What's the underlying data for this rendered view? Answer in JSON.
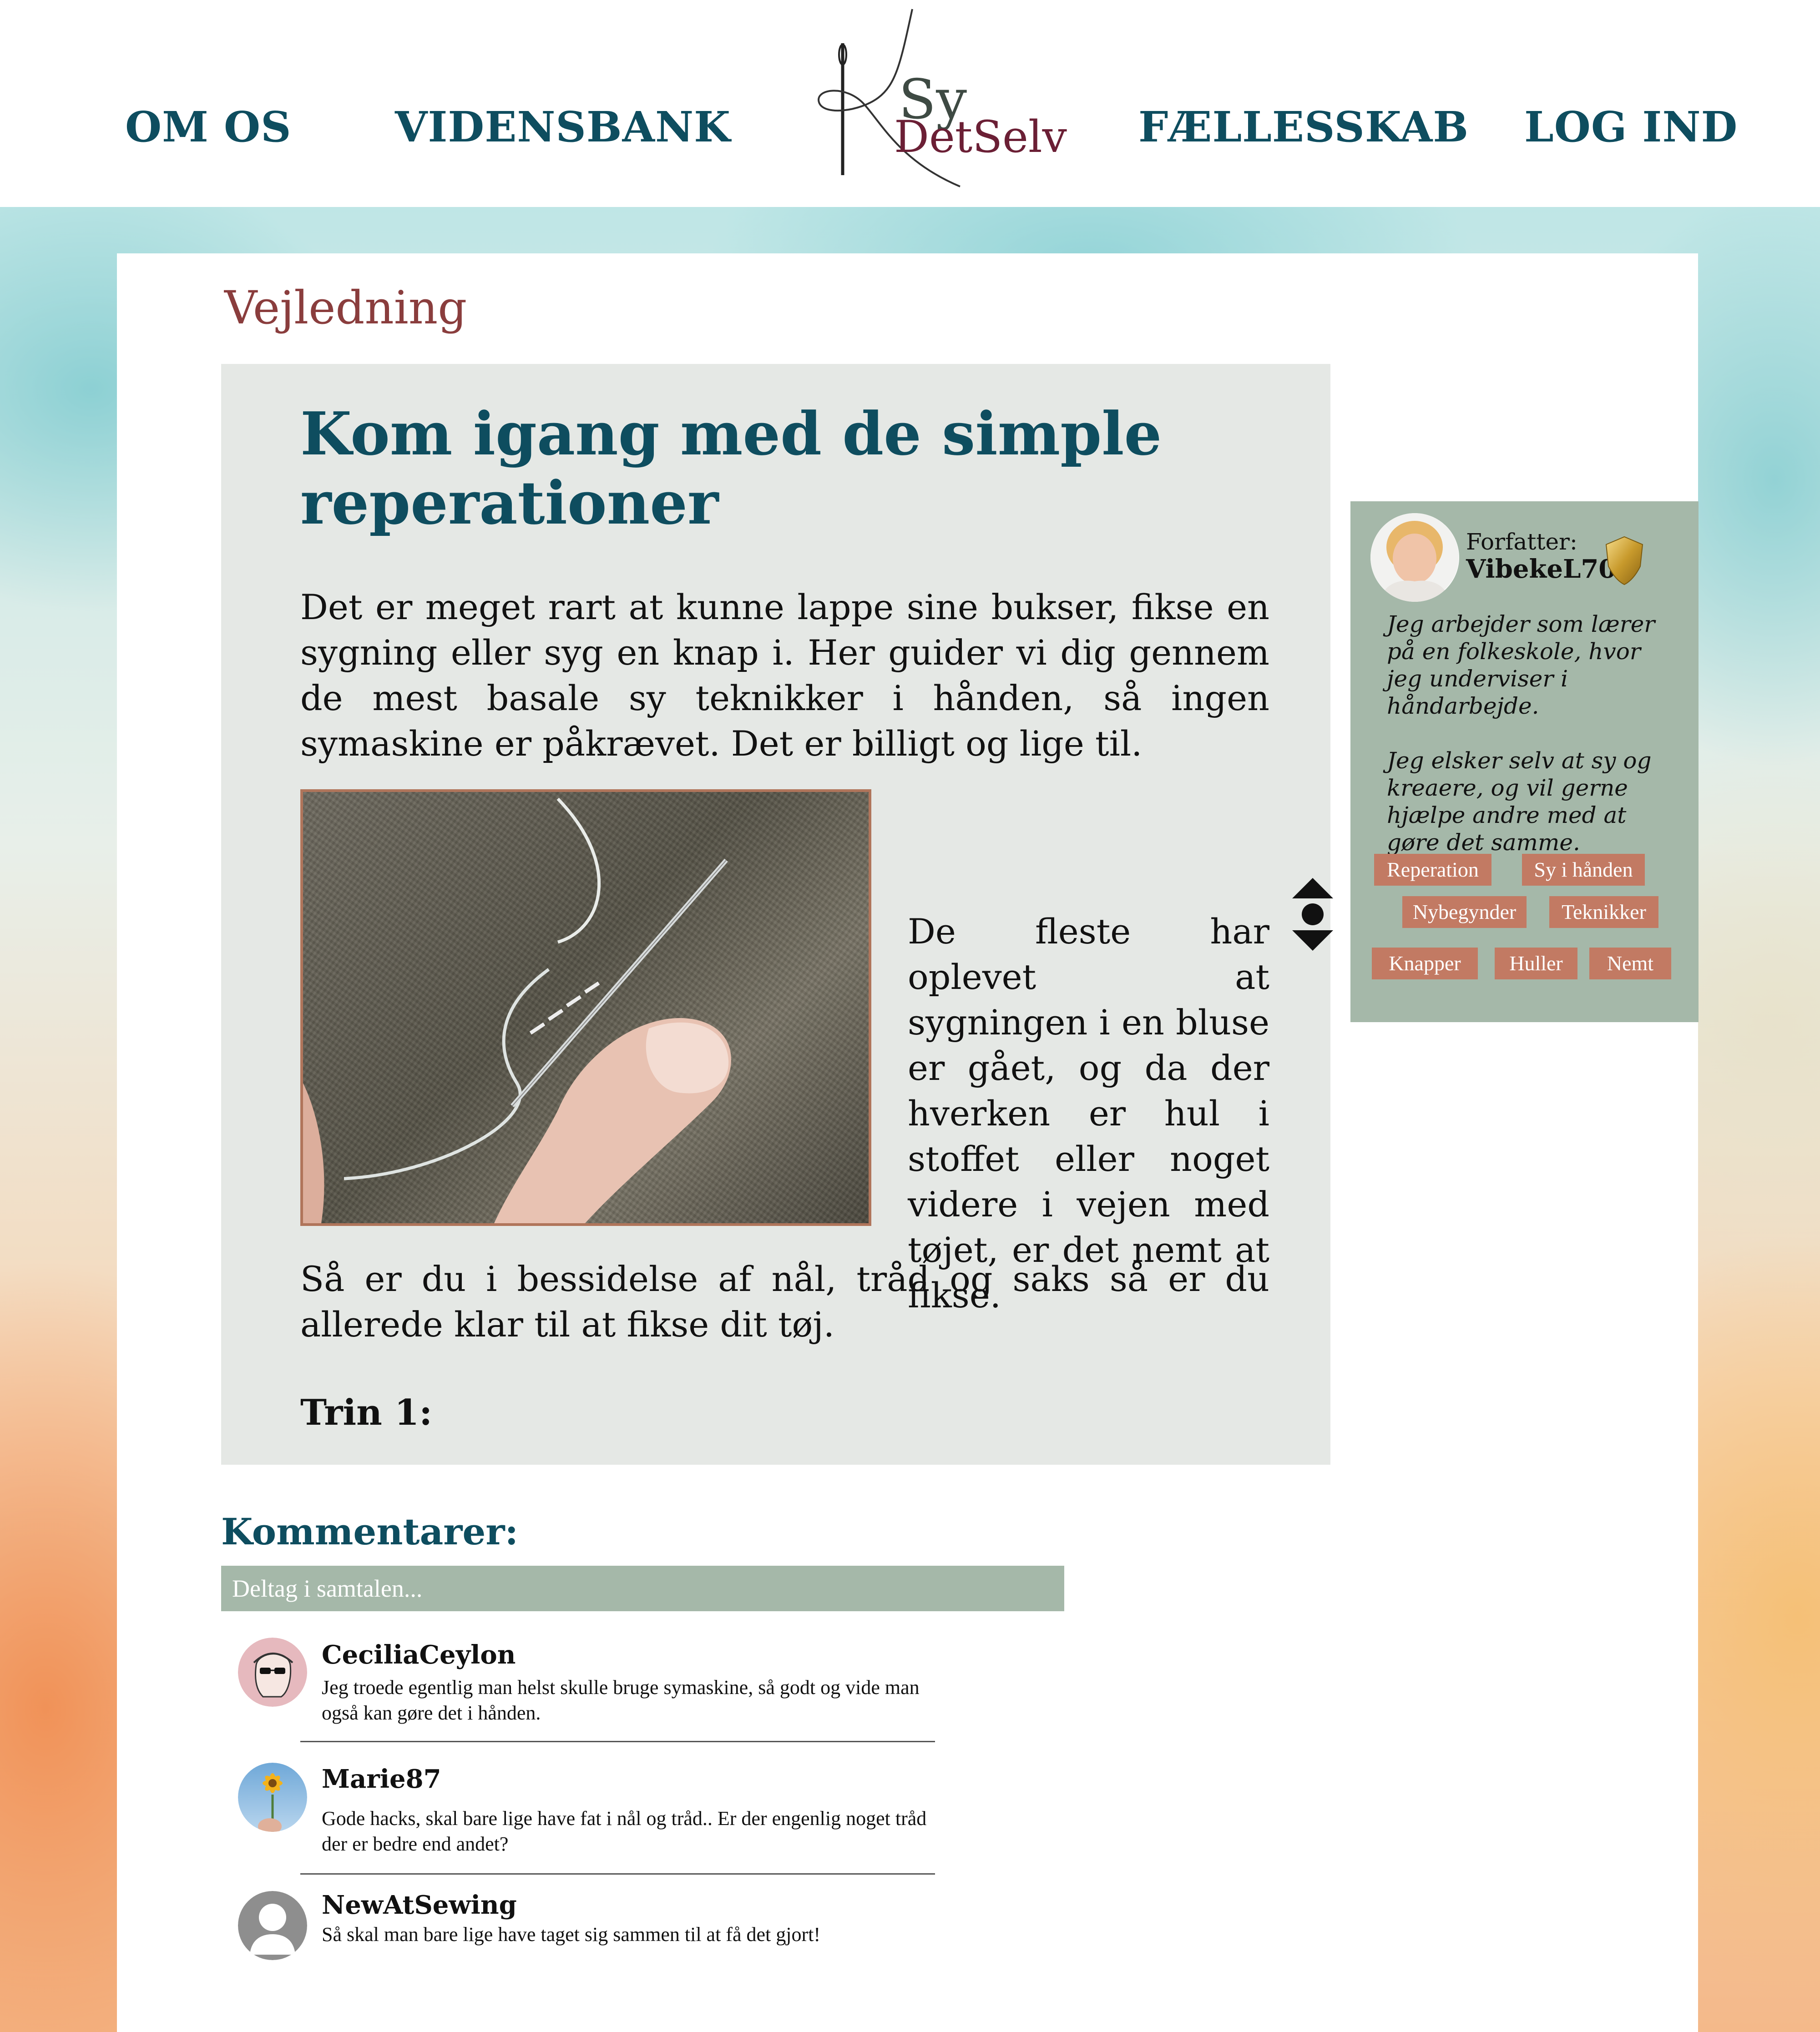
{
  "nav": {
    "items": [
      "OM OS",
      "VIDENSBANK",
      "FÆLLESSKAB",
      "LOG IND"
    ]
  },
  "logo": {
    "line1": "Sy",
    "line2": "DetSelv"
  },
  "page": {
    "section_label": "Vejledning",
    "title": "Kom igang med de simple reperationer",
    "intro": "Det er meget rart at kunne lappe sine bukser, fikse en sygning eller syg en knap i. Her guider vi dig gennem de mest basale sy teknikker i hånden, så ingen symaskine er påkrævet. Det er billigt og lige til.",
    "image_caption_text": "De fleste har oplevet at sygningen i en bluse er gået, og da der hverken er hul i stoffet eller noget videre i vejen med tøjet, er det nemt at fikse.",
    "outro": "Så er du i bessidelse af nål, tråd og saks så er du allerede klar til at fikse dit tøj.",
    "step_heading": "Trin 1:"
  },
  "author": {
    "label": "Forfatter:",
    "name": "VibekeL70",
    "bio": "Jeg arbejder som lærer på en folkeskole, hvor jeg underviser i håndarbejde.\n\nJeg elsker selv at sy og kreaere, og vil gerne hjælpe andre med at gøre det samme.",
    "tags": [
      "Reperation",
      "Sy i hånden",
      "Nybegynder",
      "Teknikker",
      "Knapper",
      "Huller",
      "Nemt"
    ]
  },
  "comments": {
    "title": "Kommentarer:",
    "placeholder": "Deltag i samtalen...",
    "items": [
      {
        "user": "CeciliaCeylon",
        "text": "Jeg troede egentlig man helst skulle bruge symaskine, så godt og vide man også kan gøre det i hånden."
      },
      {
        "user": "Marie87",
        "text": "Gode hacks, skal bare lige have fat i nål og tråd.. Er der engenlig noget tråd der er bedre end andet?"
      },
      {
        "user": "NewAtSewing",
        "text": "Så skal man bare lige have taget sig sammen til at få det gjort!"
      }
    ]
  },
  "colors": {
    "brand_teal": "#0e4d5f",
    "accent_red": "#8a3d3d",
    "sage": "#a5b8a9",
    "tag": "#c27a63",
    "article_bg": "#e5e8e5"
  }
}
